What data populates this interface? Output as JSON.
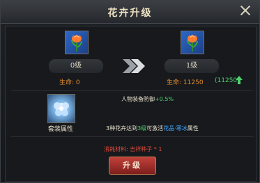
{
  "title": "花卉升级",
  "current": {
    "level": "0级",
    "stat_label": "生命",
    "stat_value": "0"
  },
  "next": {
    "level": "1级",
    "stat_label": "生命",
    "stat_value": "11250",
    "bonus": "(11250)"
  },
  "suit": {
    "label": "套装属性",
    "line1_text": "人物装备防御",
    "line1_bonus": "+0.5%",
    "line2_a": "3种花卉达到",
    "line2_level": "3级",
    "line2_b": "可激活",
    "line2_effect": "花品·寒冰",
    "line2_c": "属性"
  },
  "cost": {
    "label": "消耗材料:",
    "item": "吉祥种子 * 1"
  },
  "button": {
    "label": "升级"
  },
  "colors": {
    "accent_green": "#4fd26e",
    "warning_red": "#e24c3c",
    "stat_orange": "#e08b2f"
  },
  "icons": {
    "item": "tulip-flower-icon",
    "suit": "crystal-flower-icon",
    "arrow": "double-chevron-right-icon",
    "bonus": "green-up-arrow-icon",
    "close": "close-icon"
  }
}
